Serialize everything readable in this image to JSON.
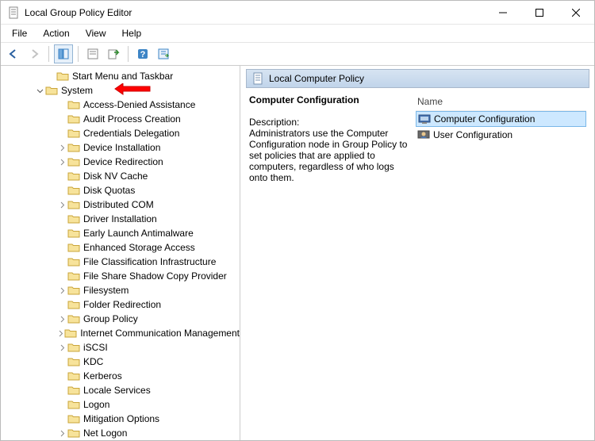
{
  "window": {
    "title": "Local Group Policy Editor"
  },
  "menu": {
    "file": "File",
    "action": "Action",
    "view": "View",
    "help": "Help"
  },
  "tree": {
    "top_item": "Start Menu and Taskbar",
    "system": "System",
    "children": [
      {
        "label": "Access-Denied Assistance",
        "expandable": false
      },
      {
        "label": "Audit Process Creation",
        "expandable": false
      },
      {
        "label": "Credentials Delegation",
        "expandable": false
      },
      {
        "label": "Device Installation",
        "expandable": true
      },
      {
        "label": "Device Redirection",
        "expandable": true
      },
      {
        "label": "Disk NV Cache",
        "expandable": false
      },
      {
        "label": "Disk Quotas",
        "expandable": false
      },
      {
        "label": "Distributed COM",
        "expandable": true
      },
      {
        "label": "Driver Installation",
        "expandable": false
      },
      {
        "label": "Early Launch Antimalware",
        "expandable": false
      },
      {
        "label": "Enhanced Storage Access",
        "expandable": false
      },
      {
        "label": "File Classification Infrastructure",
        "expandable": false
      },
      {
        "label": "File Share Shadow Copy Provider",
        "expandable": false
      },
      {
        "label": "Filesystem",
        "expandable": true
      },
      {
        "label": "Folder Redirection",
        "expandable": false
      },
      {
        "label": "Group Policy",
        "expandable": true
      },
      {
        "label": "Internet Communication Management",
        "expandable": true
      },
      {
        "label": "iSCSI",
        "expandable": true
      },
      {
        "label": "KDC",
        "expandable": false
      },
      {
        "label": "Kerberos",
        "expandable": false
      },
      {
        "label": "Locale Services",
        "expandable": false
      },
      {
        "label": "Logon",
        "expandable": false
      },
      {
        "label": "Mitigation Options",
        "expandable": false
      },
      {
        "label": "Net Logon",
        "expandable": true
      }
    ]
  },
  "right": {
    "header": "Local Computer Policy",
    "heading": "Computer Configuration",
    "desc_label": "Description:",
    "desc_text": "Administrators use the Computer Configuration node in Group Policy to set policies that are applied to computers, regardless of who logs onto them.",
    "name_col": "Name",
    "items": [
      {
        "label": "Computer Configuration",
        "selected": true
      },
      {
        "label": "User Configuration",
        "selected": false
      }
    ]
  }
}
